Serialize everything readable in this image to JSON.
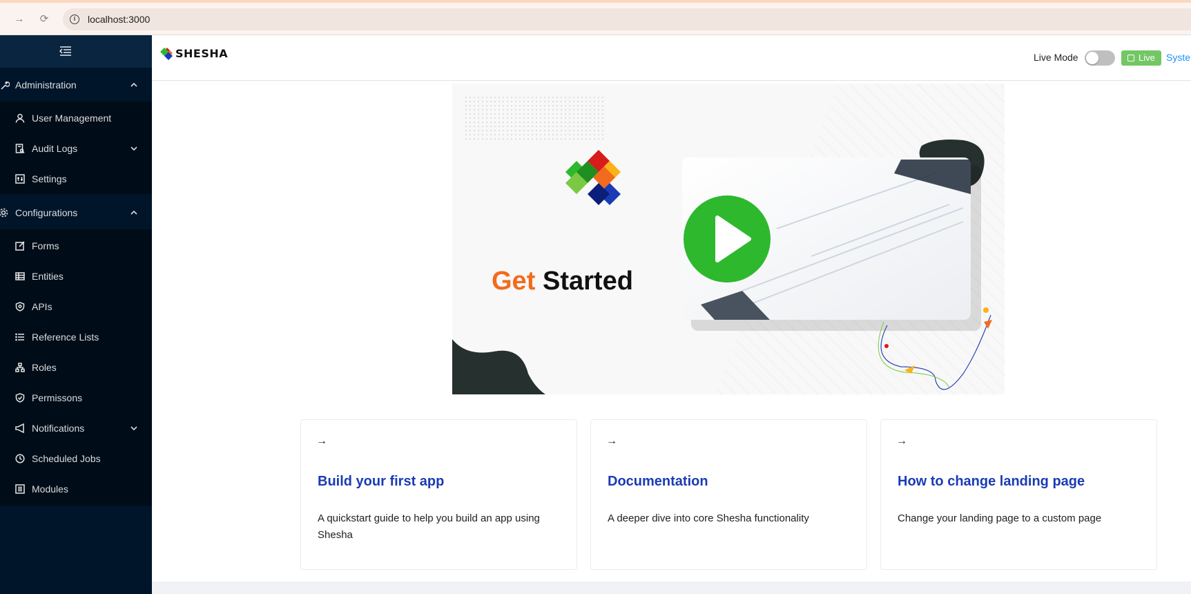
{
  "browser": {
    "url": "localhost:3000",
    "back_icon": "arrow-right-icon",
    "reload_icon": "reload-icon"
  },
  "sidebar": {
    "groups": [
      {
        "label": "Administration",
        "icon": "wrench-icon",
        "items": [
          {
            "label": "User Management",
            "icon": "user-icon"
          },
          {
            "label": "Audit Logs",
            "icon": "file-search-icon",
            "has_children": true
          },
          {
            "label": "Settings",
            "icon": "settings-icon"
          }
        ]
      },
      {
        "label": "Configurations",
        "icon": "gear-icon",
        "items": [
          {
            "label": "Forms",
            "icon": "form-icon"
          },
          {
            "label": "Entities",
            "icon": "table-icon"
          },
          {
            "label": "APIs",
            "icon": "api-icon"
          },
          {
            "label": "Reference Lists",
            "icon": "list-icon"
          },
          {
            "label": "Roles",
            "icon": "cluster-icon"
          },
          {
            "label": "Permissons",
            "icon": "safety-icon"
          },
          {
            "label": "Notifications",
            "icon": "notification-icon",
            "has_children": true
          },
          {
            "label": "Scheduled Jobs",
            "icon": "clock-icon"
          },
          {
            "label": "Modules",
            "icon": "module-icon"
          }
        ]
      }
    ]
  },
  "header": {
    "logo_text": "SHESHA",
    "live_mode_label": "Live Mode",
    "live_mode_on": false,
    "live_badge": "Live",
    "system_link": "Systen"
  },
  "banner": {
    "get": "Get",
    "started": "Started",
    "colors": {
      "orange": "#f26b1d",
      "green_play": "#2eb82e"
    }
  },
  "cards": [
    {
      "title": "Build your first app",
      "description": "A quickstart guide to help you build an app using Shesha",
      "arrow": "→"
    },
    {
      "title": "Documentation",
      "description": "A deeper dive into core Shesha functionality",
      "arrow": "→"
    },
    {
      "title": "How to change landing page",
      "description": "Change your landing page to a custom page",
      "arrow": "→"
    }
  ],
  "colors": {
    "sidebar_bg": "#001529",
    "submenu_bg": "#000c17",
    "card_title": "#1a3bb5",
    "live_badge": "#73c764",
    "link": "#1890ff"
  }
}
